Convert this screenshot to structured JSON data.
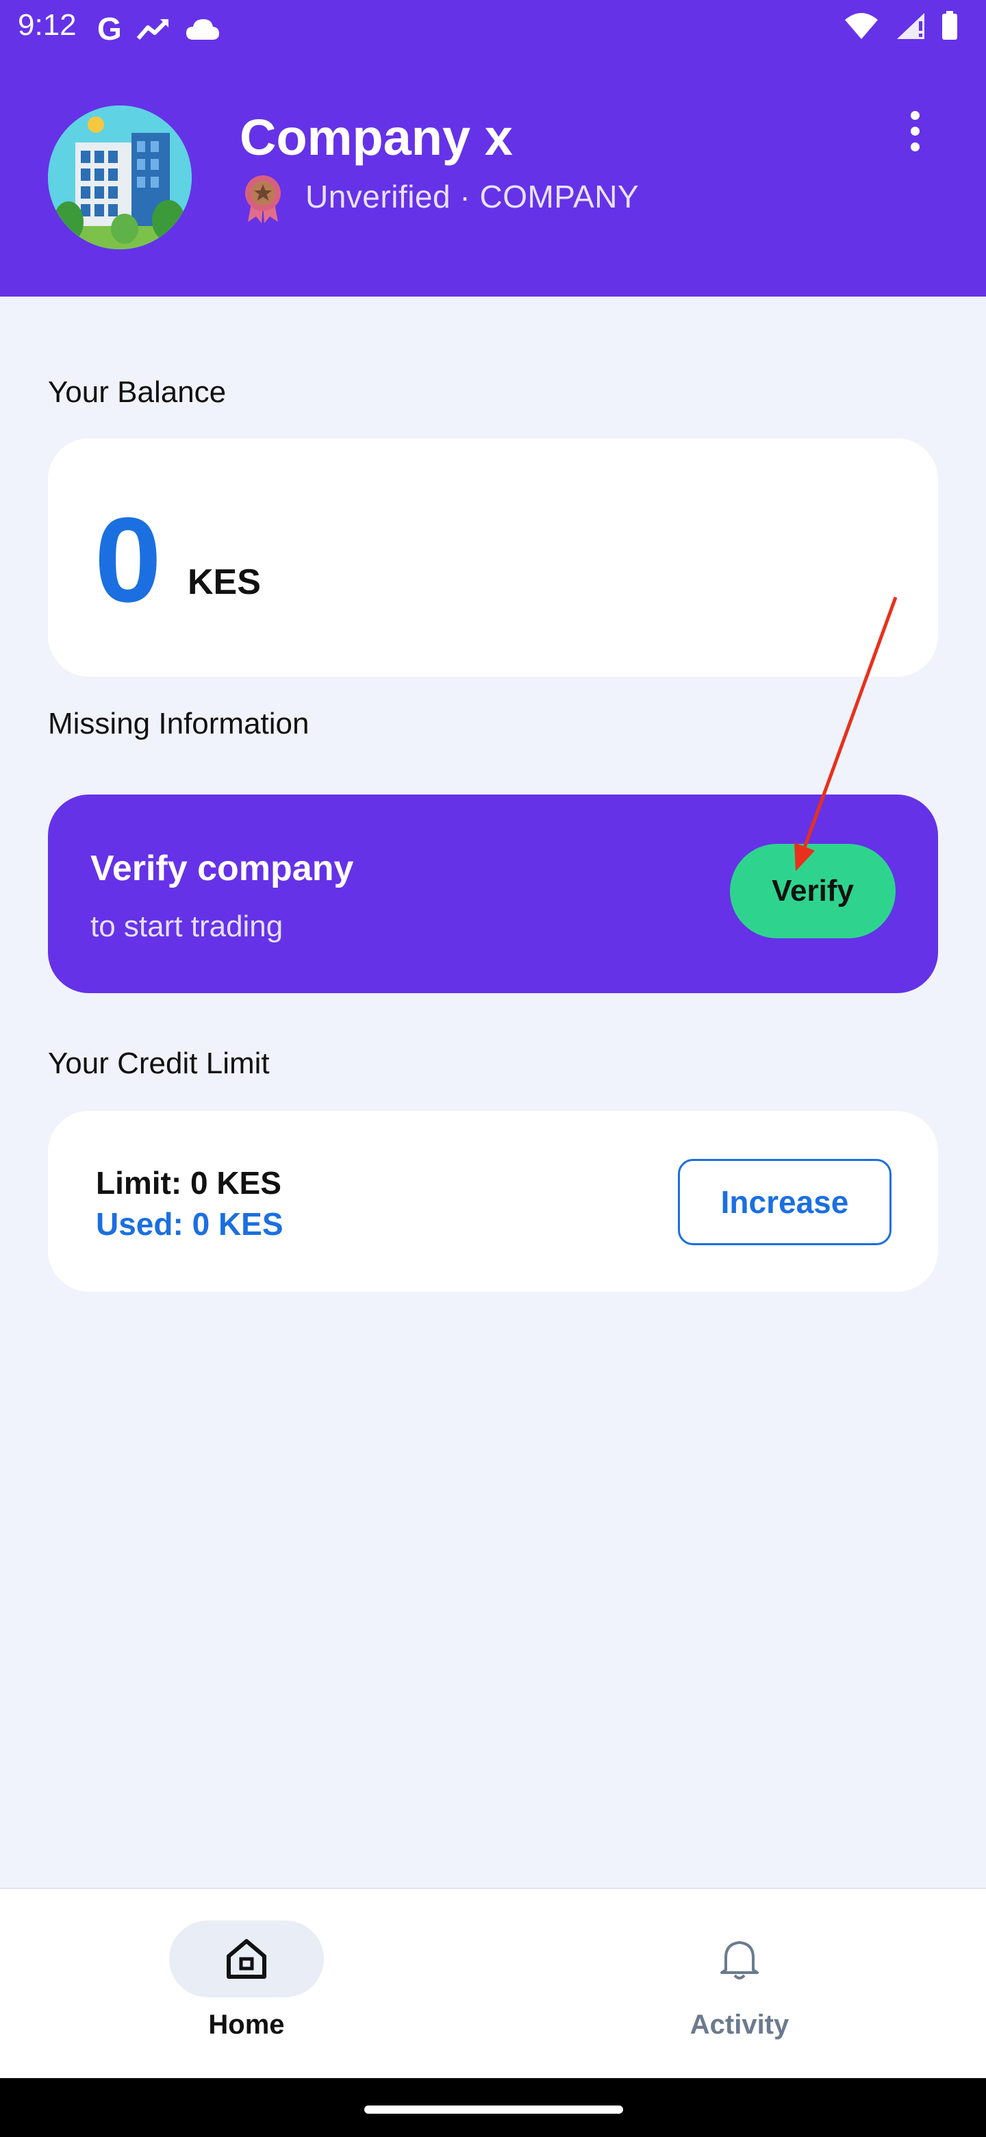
{
  "status_bar": {
    "time": "9:12",
    "left_icons": [
      "google-g-icon",
      "trending-icon",
      "cloud-icon"
    ],
    "right_icons": [
      "wifi-icon",
      "signal-icon",
      "battery-icon"
    ]
  },
  "header": {
    "company_name": "Company x",
    "subtitle": "Unverified · COMPANY",
    "background_color": "#6532e8"
  },
  "balance": {
    "label": "Your Balance",
    "amount": "0",
    "currency": "KES"
  },
  "missing_info": {
    "label": "Missing Information",
    "title": "Verify company",
    "subtitle": "to start trading",
    "button_label": "Verify"
  },
  "credit": {
    "label": "Your Credit Limit",
    "limit": "Limit: 0 KES",
    "used": "Used: 0 KES",
    "button_label": "Increase"
  },
  "bottom_nav": {
    "items": [
      {
        "label": "Home",
        "icon": "home-icon",
        "active": true
      },
      {
        "label": "Activity",
        "icon": "bell-icon",
        "active": false
      }
    ]
  },
  "colors": {
    "accent": "#6532e8",
    "primary_blue": "#1b6fe0",
    "verify_green": "#2ed48e",
    "annotation_arrow": "#e8301c"
  }
}
